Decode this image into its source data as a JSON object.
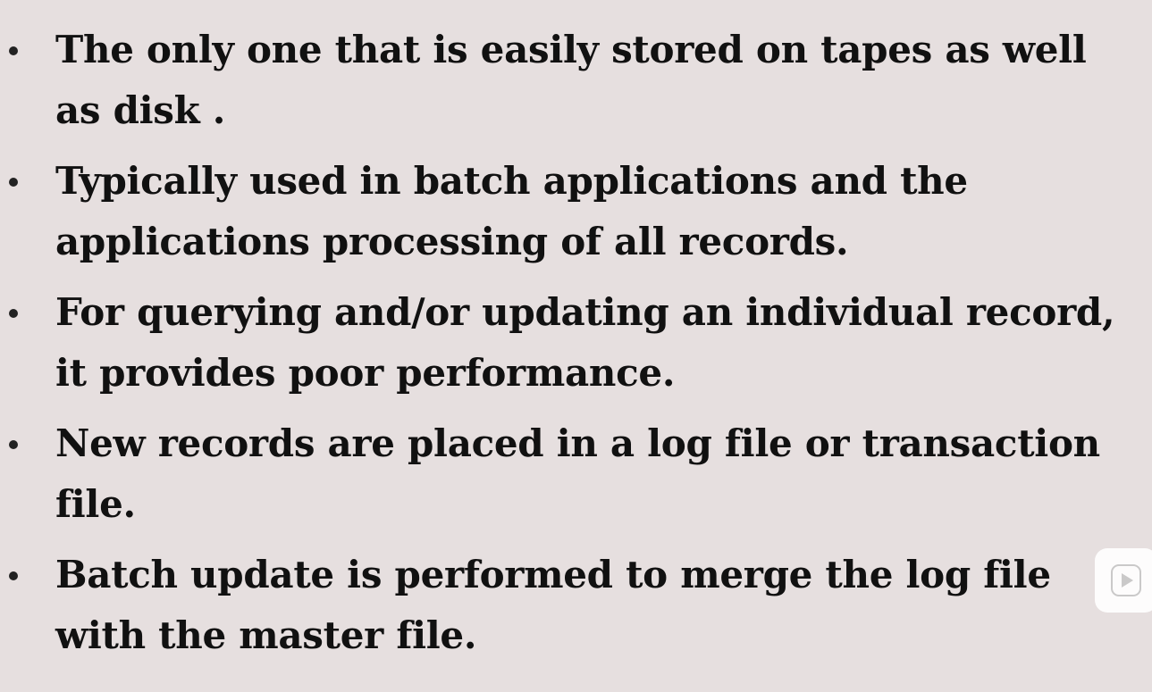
{
  "slide": {
    "bullets": [
      {
        "text": "The only one that is easily stored on tapes as well as disk ."
      },
      {
        "text": "Typically used in batch applications and the applications processing of all records."
      },
      {
        "text": "For querying and/or updating an individual record,  it provides poor performance."
      },
      {
        "text": "New records are placed in a log file or transaction file."
      },
      {
        "text": "Batch update is performed to merge the log file with the master file."
      }
    ]
  },
  "colors": {
    "background": "#e6dfdf",
    "text": "#111111",
    "overlay": "#ffffff"
  },
  "icons": {
    "overlay": "play-icon"
  }
}
